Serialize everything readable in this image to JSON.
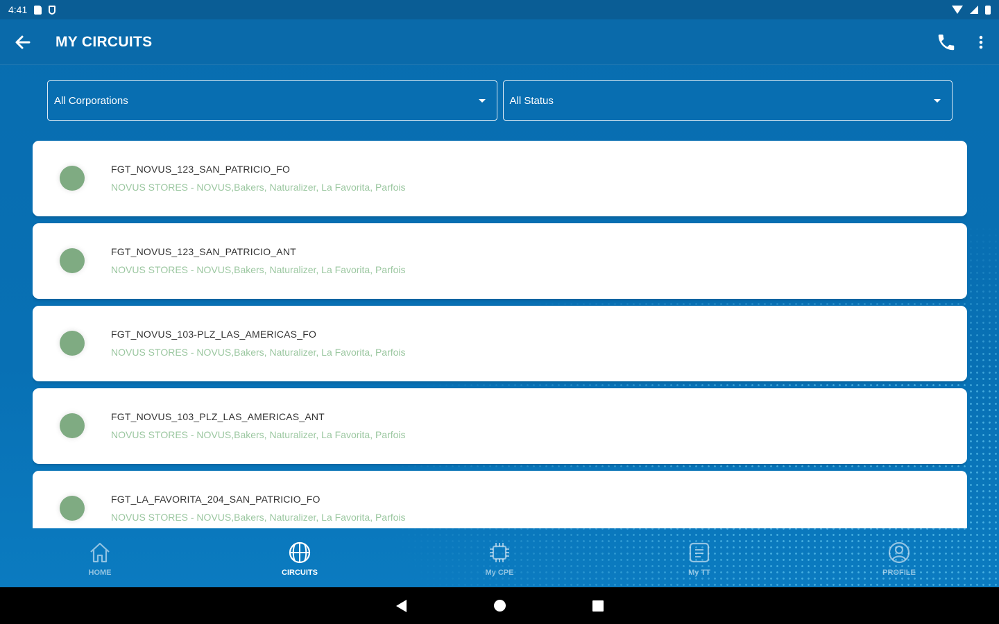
{
  "status_bar": {
    "time": "4:41"
  },
  "toolbar": {
    "title": "MY CIRCUITS"
  },
  "filters": {
    "corporation": "All Corporations",
    "status": "All Status"
  },
  "circuits": [
    {
      "name": "FGT_NOVUS_123_SAN_PATRICIO_FO",
      "corporation": "NOVUS STORES - NOVUS,Bakers, Naturalizer, La Favorita, Parfois",
      "status_color": "#7fab82"
    },
    {
      "name": "FGT_NOVUS_123_SAN_PATRICIO_ANT",
      "corporation": "NOVUS STORES - NOVUS,Bakers, Naturalizer, La Favorita, Parfois",
      "status_color": "#7fab82"
    },
    {
      "name": "FGT_NOVUS_103-PLZ_LAS_AMERICAS_FO",
      "corporation": "NOVUS STORES - NOVUS,Bakers, Naturalizer, La Favorita, Parfois",
      "status_color": "#7fab82"
    },
    {
      "name": "FGT_NOVUS_103_PLZ_LAS_AMERICAS_ANT",
      "corporation": "NOVUS STORES - NOVUS,Bakers, Naturalizer, La Favorita, Parfois",
      "status_color": "#7fab82"
    },
    {
      "name": "FGT_LA_FAVORITA_204_SAN_PATRICIO_FO",
      "corporation": "NOVUS STORES - NOVUS,Bakers, Naturalizer, La Favorita, Parfois",
      "status_color": "#7fab82"
    }
  ],
  "bottom_nav": {
    "items": [
      {
        "label": "HOME",
        "icon": "home-icon",
        "active": false
      },
      {
        "label": "CIRCUITS",
        "icon": "globe-icon",
        "active": true
      },
      {
        "label": "My CPE",
        "icon": "chip-icon",
        "active": false
      },
      {
        "label": "My TT",
        "icon": "ticket-icon",
        "active": false
      },
      {
        "label": "PROFILE",
        "icon": "profile-icon",
        "active": false
      }
    ]
  },
  "colors": {
    "primary": "#086db0",
    "status_ok": "#7fab82",
    "subtitle": "#9bc7a0"
  }
}
